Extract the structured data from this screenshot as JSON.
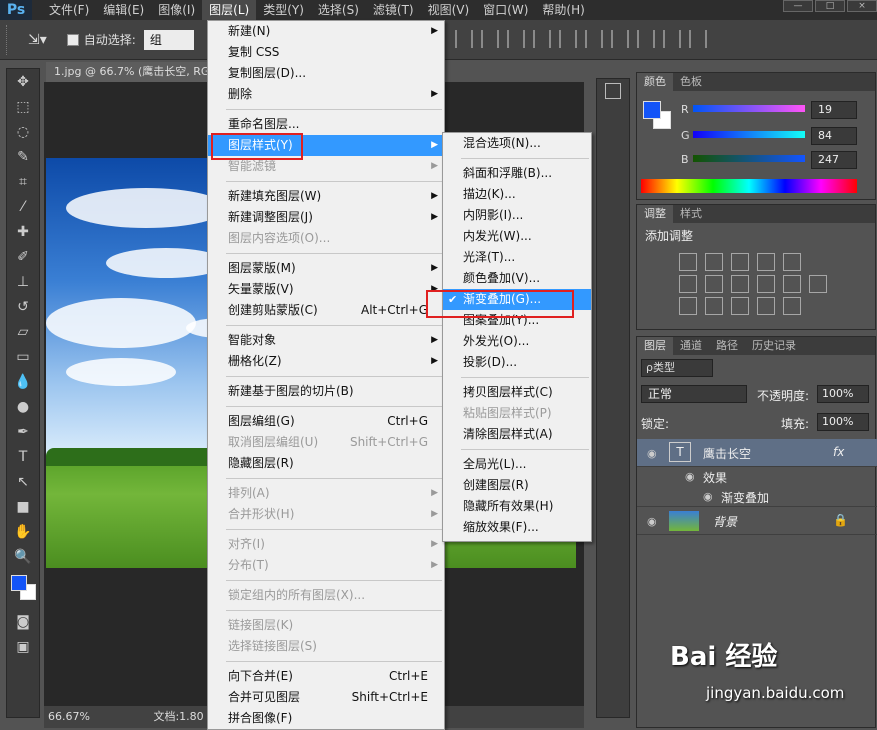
{
  "app": {
    "logo": "Ps"
  },
  "menubar": [
    "文件(F)",
    "编辑(E)",
    "图像(I)",
    "图层(L)",
    "类型(Y)",
    "选择(S)",
    "滤镜(T)",
    "视图(V)",
    "窗口(W)",
    "帮助(H)"
  ],
  "menubar_active_index": 3,
  "options_bar": {
    "auto_select_label": "自动选择:",
    "auto_select_value": "组"
  },
  "document": {
    "tab_title": "1.jpg @ 66.7% (鹰击长空, RG",
    "zoom": "66.67%",
    "doc_info": "文档:1.80"
  },
  "layer_menu": [
    {
      "label": "新建(N)",
      "arrow": true
    },
    {
      "label": "复制 CSS"
    },
    {
      "label": "复制图层(D)..."
    },
    {
      "label": "删除",
      "arrow": true
    },
    {
      "sep": true
    },
    {
      "label": "重命名图层..."
    },
    {
      "label": "图层样式(Y)",
      "arrow": true,
      "highlight": true
    },
    {
      "label": "智能滤镜",
      "arrow": true,
      "disabled": true
    },
    {
      "sep": true
    },
    {
      "label": "新建填充图层(W)",
      "arrow": true
    },
    {
      "label": "新建调整图层(J)",
      "arrow": true
    },
    {
      "label": "图层内容选项(O)...",
      "disabled": true
    },
    {
      "sep": true
    },
    {
      "label": "图层蒙版(M)",
      "arrow": true
    },
    {
      "label": "矢量蒙版(V)",
      "arrow": true
    },
    {
      "label": "创建剪贴蒙版(C)",
      "shortcut": "Alt+Ctrl+G"
    },
    {
      "sep": true
    },
    {
      "label": "智能对象",
      "arrow": true
    },
    {
      "label": "栅格化(Z)",
      "arrow": true
    },
    {
      "sep": true
    },
    {
      "label": "新建基于图层的切片(B)"
    },
    {
      "sep": true
    },
    {
      "label": "图层编组(G)",
      "shortcut": "Ctrl+G"
    },
    {
      "label": "取消图层编组(U)",
      "shortcut": "Shift+Ctrl+G",
      "disabled": true
    },
    {
      "label": "隐藏图层(R)"
    },
    {
      "sep": true
    },
    {
      "label": "排列(A)",
      "arrow": true,
      "disabled": true
    },
    {
      "label": "合并形状(H)",
      "arrow": true,
      "disabled": true
    },
    {
      "sep": true
    },
    {
      "label": "对齐(I)",
      "arrow": true,
      "disabled": true
    },
    {
      "label": "分布(T)",
      "arrow": true,
      "disabled": true
    },
    {
      "sep": true
    },
    {
      "label": "锁定组内的所有图层(X)...",
      "disabled": true
    },
    {
      "sep": true
    },
    {
      "label": "链接图层(K)",
      "disabled": true
    },
    {
      "label": "选择链接图层(S)",
      "disabled": true
    },
    {
      "sep": true
    },
    {
      "label": "向下合并(E)",
      "shortcut": "Ctrl+E"
    },
    {
      "label": "合并可见图层",
      "shortcut": "Shift+Ctrl+E"
    },
    {
      "label": "拼合图像(F)"
    }
  ],
  "style_submenu": [
    {
      "label": "混合选项(N)..."
    },
    {
      "sep": true
    },
    {
      "label": "斜面和浮雕(B)..."
    },
    {
      "label": "描边(K)..."
    },
    {
      "label": "内阴影(I)..."
    },
    {
      "label": "内发光(W)..."
    },
    {
      "label": "光泽(T)..."
    },
    {
      "label": "颜色叠加(V)..."
    },
    {
      "label": "渐变叠加(G)...",
      "highlight": true,
      "checked": true
    },
    {
      "label": "图案叠加(Y)..."
    },
    {
      "label": "外发光(O)..."
    },
    {
      "label": "投影(D)..."
    },
    {
      "sep": true
    },
    {
      "label": "拷贝图层样式(C)"
    },
    {
      "label": "粘贴图层样式(P)",
      "disabled": true
    },
    {
      "label": "清除图层样式(A)"
    },
    {
      "sep": true
    },
    {
      "label": "全局光(L)..."
    },
    {
      "label": "创建图层(R)"
    },
    {
      "label": "隐藏所有效果(H)"
    },
    {
      "label": "缩放效果(F)..."
    }
  ],
  "color_panel": {
    "tabs": [
      "颜色",
      "色板"
    ],
    "r": "19",
    "g": "84",
    "b": "247",
    "r_label": "R",
    "g_label": "G",
    "b_label": "B",
    "fg": "#1354f7"
  },
  "adjust_panel": {
    "tabs": [
      "调整",
      "样式"
    ],
    "title": "添加调整"
  },
  "layers_panel": {
    "tabs": [
      "图层",
      "通道",
      "路径",
      "历史记录"
    ],
    "filter": "ρ类型",
    "blend_mode": "正常",
    "opacity_label": "不透明度:",
    "opacity": "100%",
    "lock_label": "锁定:",
    "fill_label": "填充:",
    "fill": "100%",
    "layers": [
      {
        "name": "鹰击长空",
        "type": "T",
        "fx": "fx"
      },
      {
        "name": "效果"
      },
      {
        "name": "渐变叠加"
      },
      {
        "name": "背景"
      }
    ]
  },
  "watermark": {
    "brand": "Bai 经验",
    "url": "jingyan.baidu.com"
  }
}
